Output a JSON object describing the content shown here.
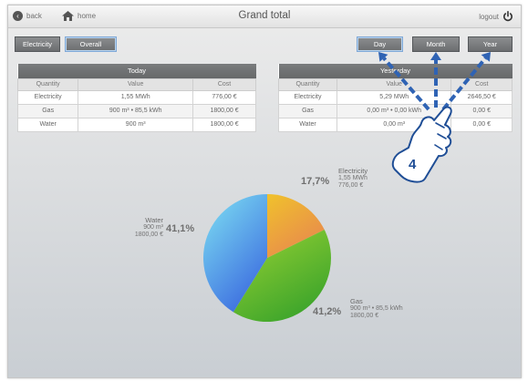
{
  "header": {
    "back_label": "back",
    "home_label": "home",
    "title": "Grand total",
    "logout_label": "logout"
  },
  "toggles": {
    "electricity": "Electricity",
    "overall": "Overall",
    "selected": "Overall"
  },
  "periods": {
    "day": "Day",
    "month": "Month",
    "year": "Year"
  },
  "tables": {
    "columns": [
      "Quantity",
      "Value",
      "Cost"
    ],
    "today": {
      "caption": "Today",
      "rows": [
        [
          "Electricity",
          "1,55 MWh",
          "776,00 €"
        ],
        [
          "Gas",
          "900 m³ • 85,5 kWh",
          "1800,00 €"
        ],
        [
          "Water",
          "900 m³",
          "1800,00 €"
        ]
      ]
    },
    "yesterday": {
      "caption": "Yesterday",
      "rows": [
        [
          "Electricity",
          "5,29 MWh",
          "2646,50 €"
        ],
        [
          "Gas",
          "0,00 m³ • 0,00 kWh",
          "0,00 €"
        ],
        [
          "Water",
          "0,00 m³",
          "0,00 €"
        ]
      ]
    }
  },
  "pie": {
    "slices": [
      {
        "name": "Electricity",
        "percent": 17.7,
        "percent_label": "17,7%",
        "value": "1,55 MWh",
        "cost": "776,00 €",
        "color_a": "#f0c22c",
        "color_b": "#e8894d"
      },
      {
        "name": "Gas",
        "percent": 41.2,
        "percent_label": "41,2%",
        "value": "900 m³ • 85,5 kWh",
        "cost": "1800,00 €",
        "color_a": "#9ad233",
        "color_b": "#3da52b"
      },
      {
        "name": "Water",
        "percent": 41.1,
        "percent_label": "41,1%",
        "value": "900 m³",
        "cost": "1800,00 €",
        "color_a": "#7fe3f3",
        "color_b": "#3e6fe0"
      }
    ]
  },
  "annotation": {
    "step_number": "4",
    "arrow_color": "#2f63b4",
    "icon": "hand-swipe-up-icon"
  }
}
